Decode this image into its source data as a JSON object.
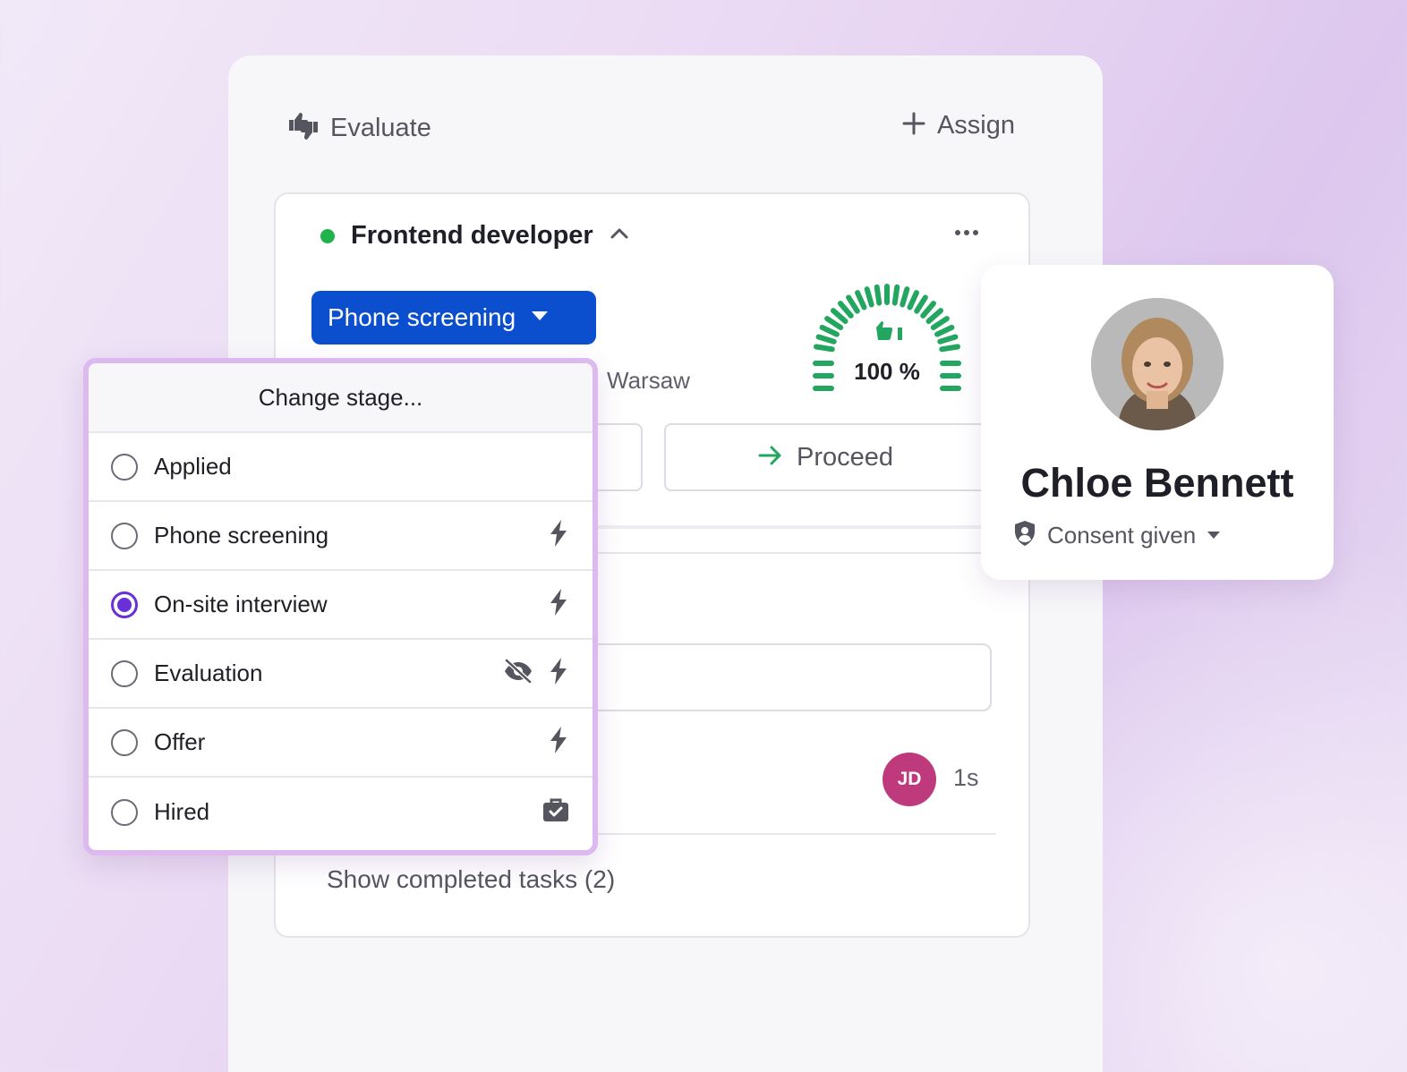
{
  "header": {
    "evaluate_label": "Evaluate",
    "assign_label": "Assign"
  },
  "job": {
    "title": "Frontend developer",
    "status_color": "#22b24c",
    "stage_button_label": "Phone screening",
    "location": "Warsaw",
    "match_score": "100 %",
    "match_fraction": 1.0,
    "proceed_label": "Proceed"
  },
  "tasks": {
    "assignee_initials": "JD",
    "time": "1s",
    "show_completed_label": "Show completed tasks (2)"
  },
  "stage_menu": {
    "title": "Change stage...",
    "items": [
      {
        "label": "Applied",
        "selected": false,
        "icons": []
      },
      {
        "label": "Phone screening",
        "selected": false,
        "icons": [
          "bolt-icon"
        ]
      },
      {
        "label": "On-site interview",
        "selected": true,
        "icons": [
          "bolt-icon"
        ]
      },
      {
        "label": "Evaluation",
        "selected": false,
        "icons": [
          "eye-slash-icon",
          "bolt-icon"
        ]
      },
      {
        "label": "Offer",
        "selected": false,
        "icons": [
          "bolt-icon"
        ]
      },
      {
        "label": "Hired",
        "selected": false,
        "icons": [
          "briefcase-check-icon"
        ]
      }
    ]
  },
  "candidate": {
    "name": "Chloe Bennett",
    "consent_label": "Consent given"
  },
  "colors": {
    "primary": "#0b4fcf",
    "radio_selected": "#6a2fd6",
    "dropdown_border": "#dcb9ef",
    "gauge": "#22a660",
    "avatar_jd": "#bf3a7c"
  }
}
